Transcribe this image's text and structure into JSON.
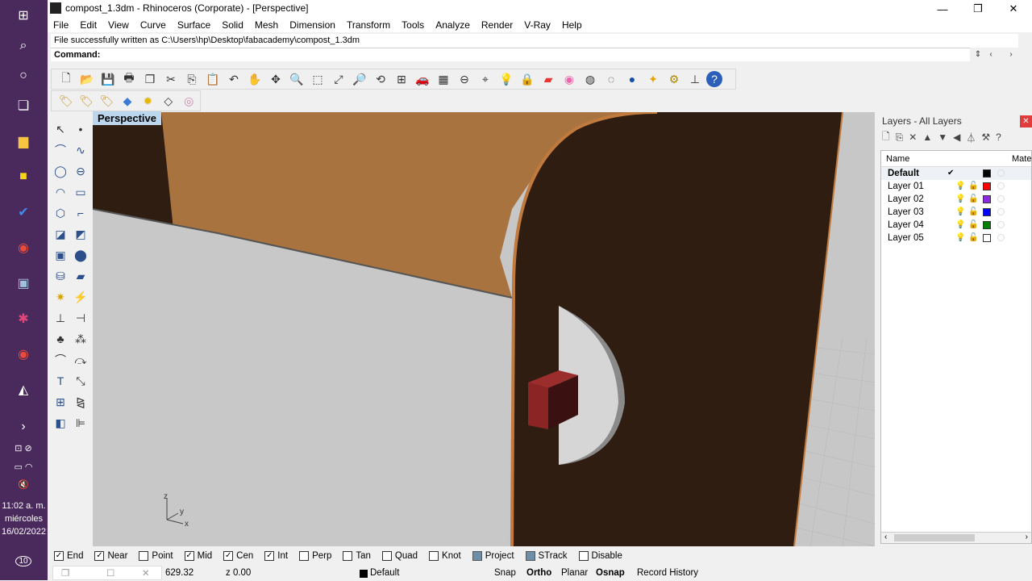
{
  "taskbar": {
    "clock_time": "11:02 a. m.",
    "clock_day": "miércoles",
    "clock_date": "16/02/2022",
    "notif_count": "10",
    "icons": [
      "windows-icon",
      "search-icon",
      "cortana-icon",
      "taskview-icon",
      "file-explorer-icon",
      "sticky-notes-icon",
      "todo-icon",
      "chrome-icon",
      "photos-icon",
      "slack-icon",
      "chrome-e-icon",
      "inkscape-icon"
    ]
  },
  "window": {
    "title": "compost_1.3dm - Rhinoceros (Corporate) - [Perspective]",
    "min": "—",
    "max": "❐",
    "close": "✕"
  },
  "menu": [
    "File",
    "Edit",
    "View",
    "Curve",
    "Surface",
    "Solid",
    "Mesh",
    "Dimension",
    "Transform",
    "Tools",
    "Analyze",
    "Render",
    "V-Ray",
    "Help"
  ],
  "command": {
    "history": "File successfully written as C:\\Users\\hp\\Desktop\\fabacademy\\compost_1.3dm",
    "prompt": "Command:"
  },
  "viewport": {
    "label": "Perspective",
    "axis_z": "z",
    "axis_y": "y",
    "axis_x": "x"
  },
  "layers": {
    "title": "Layers - All Layers",
    "col_name": "Name",
    "col_material": "Mater",
    "rows": [
      {
        "name": "Default",
        "current": true,
        "color": "#000000"
      },
      {
        "name": "Layer 01",
        "current": false,
        "color": "#ff0000"
      },
      {
        "name": "Layer 02",
        "current": false,
        "color": "#8a2be2"
      },
      {
        "name": "Layer 03",
        "current": false,
        "color": "#0000ff"
      },
      {
        "name": "Layer 04",
        "current": false,
        "color": "#008000"
      },
      {
        "name": "Layer 05",
        "current": false,
        "color": "#ffffff"
      }
    ]
  },
  "osnap": [
    {
      "label": "End",
      "checked": true
    },
    {
      "label": "Near",
      "checked": true
    },
    {
      "label": "Point",
      "checked": false
    },
    {
      "label": "Mid",
      "checked": true
    },
    {
      "label": "Cen",
      "checked": true
    },
    {
      "label": "Int",
      "checked": true
    },
    {
      "label": "Perp",
      "checked": false
    },
    {
      "label": "Tan",
      "checked": false
    },
    {
      "label": "Quad",
      "checked": false
    },
    {
      "label": "Knot",
      "checked": false
    },
    {
      "label": "Project",
      "checked": false,
      "filled": true
    },
    {
      "label": "STrack",
      "checked": false,
      "filled": true
    },
    {
      "label": "Disable",
      "checked": false
    }
  ],
  "status": {
    "y_coord": "629.32",
    "z_coord": "z 0.00",
    "layer": "Default",
    "snap": "Snap",
    "ortho": "Ortho",
    "planar": "Planar",
    "osnap": "Osnap",
    "record_history": "Record History"
  }
}
